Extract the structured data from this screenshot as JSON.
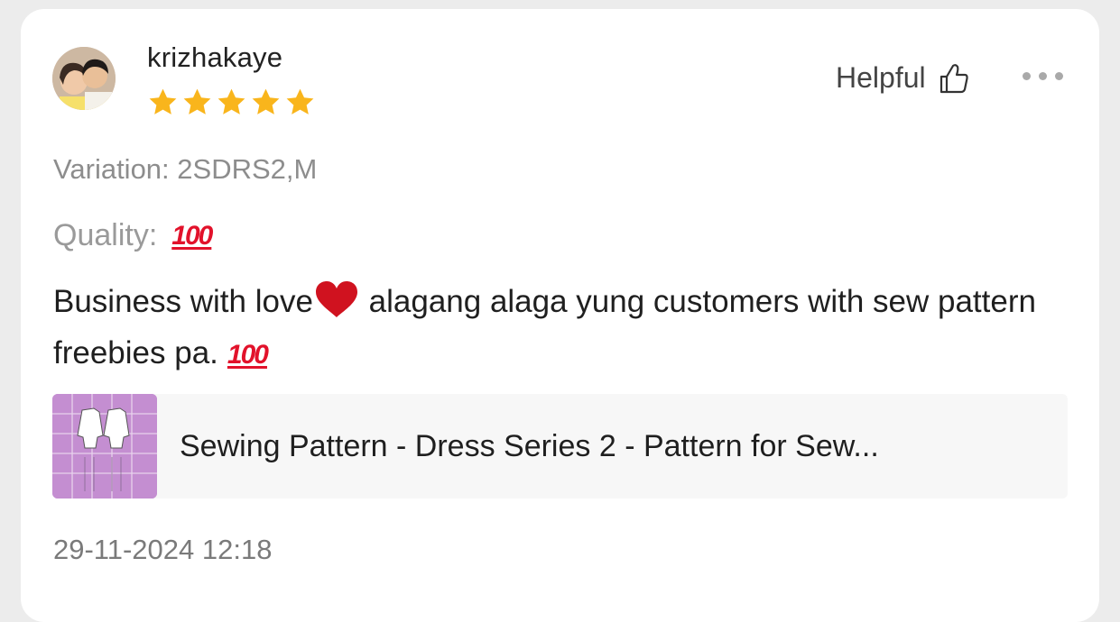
{
  "review": {
    "username": "krizhakaye",
    "rating": 5,
    "helpful_label": "Helpful",
    "variation": "Variation: 2SDRS2,M",
    "quality_label": "Quality:",
    "quality_value": "💯",
    "body_part1": "Business with love",
    "body_heart": "❤️",
    "body_part2": " alagang alaga yung customers with sew pattern freebies pa.",
    "body_emoji": "💯",
    "product_title": "Sewing Pattern - Dress Series 2 - Pattern for Sew...",
    "timestamp": "29-11-2024 12:18"
  },
  "colors": {
    "star": "#f9b51c",
    "accent_red": "#e2122b",
    "thumbnail_bg": "#c48ed1"
  },
  "icons": {
    "helpful": "thumbs-up-icon",
    "more": "more-options-icon",
    "star": "star-icon"
  }
}
